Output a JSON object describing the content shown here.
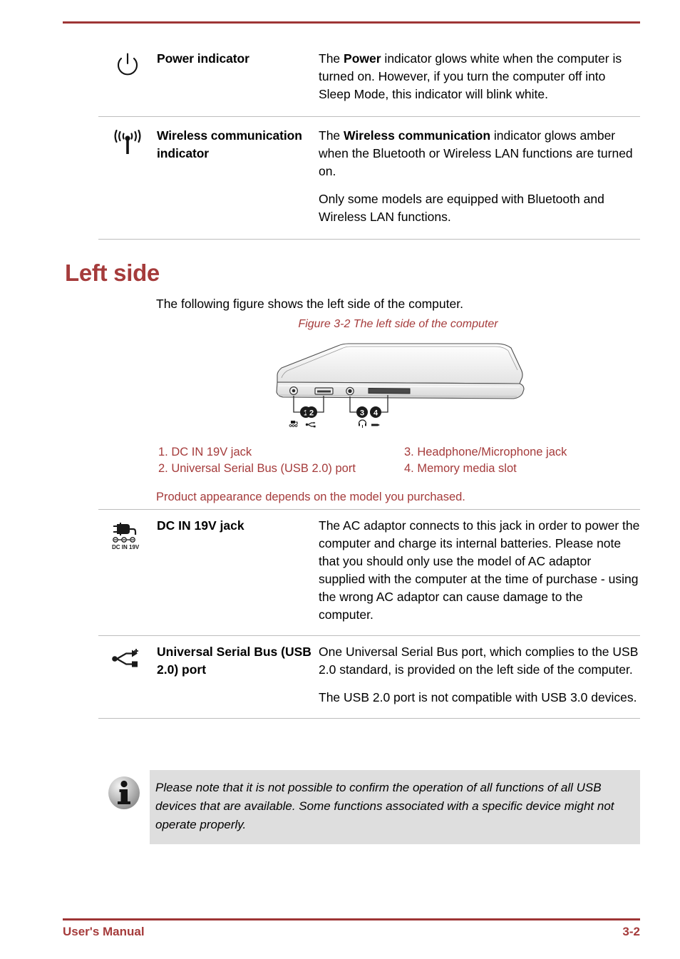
{
  "document": {
    "type": "user-manual-page",
    "accent_color": "#a53b3b",
    "rule_color": "#9e3535",
    "body_text_color": "#000000",
    "info_box_bg": "#dedede"
  },
  "indicator_table": {
    "rows": [
      {
        "icon": "power-icon",
        "name": "Power indicator",
        "paragraphs": [
          {
            "segments": [
              {
                "text": "The ",
                "bold": false
              },
              {
                "text": "Power",
                "bold": true
              },
              {
                "text": " indicator glows white when the computer is turned on. However, if you turn the computer off into Sleep Mode, this indicator will blink white.",
                "bold": false
              }
            ]
          }
        ]
      },
      {
        "icon": "wireless-communication-icon",
        "name": "Wireless communication indicator",
        "paragraphs": [
          {
            "segments": [
              {
                "text": "The ",
                "bold": false
              },
              {
                "text": "Wireless communication",
                "bold": true
              },
              {
                "text": " indicator glows amber when the Bluetooth or Wireless LAN functions are turned on.",
                "bold": false
              }
            ]
          },
          {
            "segments": [
              {
                "text": "Only some models are equipped with Bluetooth and Wireless LAN functions.",
                "bold": false
              }
            ]
          }
        ]
      }
    ]
  },
  "section": {
    "heading": "Left side",
    "intro": "The following figure shows the left side of the computer.",
    "figure_caption": "Figure 3-2 The left side of the computer",
    "figure": {
      "alt": "Left side view of laptop computer showing ports",
      "callouts": [
        {
          "number": "1",
          "icon": "dc-in-icon"
        },
        {
          "number": "2",
          "icon": "usb-icon"
        },
        {
          "number": "3",
          "icon": "headphone-icon"
        },
        {
          "number": "4",
          "icon": "memory-card-icon"
        }
      ]
    },
    "legend": [
      "1. DC IN 19V jack",
      "2. Universal Serial Bus (USB 2.0) port",
      "3. Headphone/Microphone jack",
      "4. Memory media slot"
    ],
    "product_note": "Product appearance depends on the model you purchased."
  },
  "port_table": {
    "rows": [
      {
        "icon": "dc-in-19v-icon",
        "icon_label": "DC IN 19V",
        "name": "DC IN 19V jack",
        "paragraphs": [
          "The AC adaptor connects to this jack in order to power the computer and charge its internal batteries. Please note that you should only use the model of AC adaptor supplied with the computer at the time of purchase - using the wrong AC adaptor can cause damage to the computer."
        ]
      },
      {
        "icon": "usb-icon",
        "icon_label": "",
        "name": "Universal Serial Bus (USB 2.0) port",
        "paragraphs": [
          "One Universal Serial Bus port, which complies to the USB 2.0 standard, is provided on the left side of the computer.",
          "The USB 2.0 port is not compatible with USB 3.0 devices."
        ]
      }
    ]
  },
  "info_box": {
    "icon": "info-icon",
    "text": "Please note that it is not possible to confirm the operation of all functions of all USB devices that are available. Some functions associated with a specific device might not operate properly."
  },
  "footer": {
    "left": "User's Manual",
    "right": "3-2"
  }
}
